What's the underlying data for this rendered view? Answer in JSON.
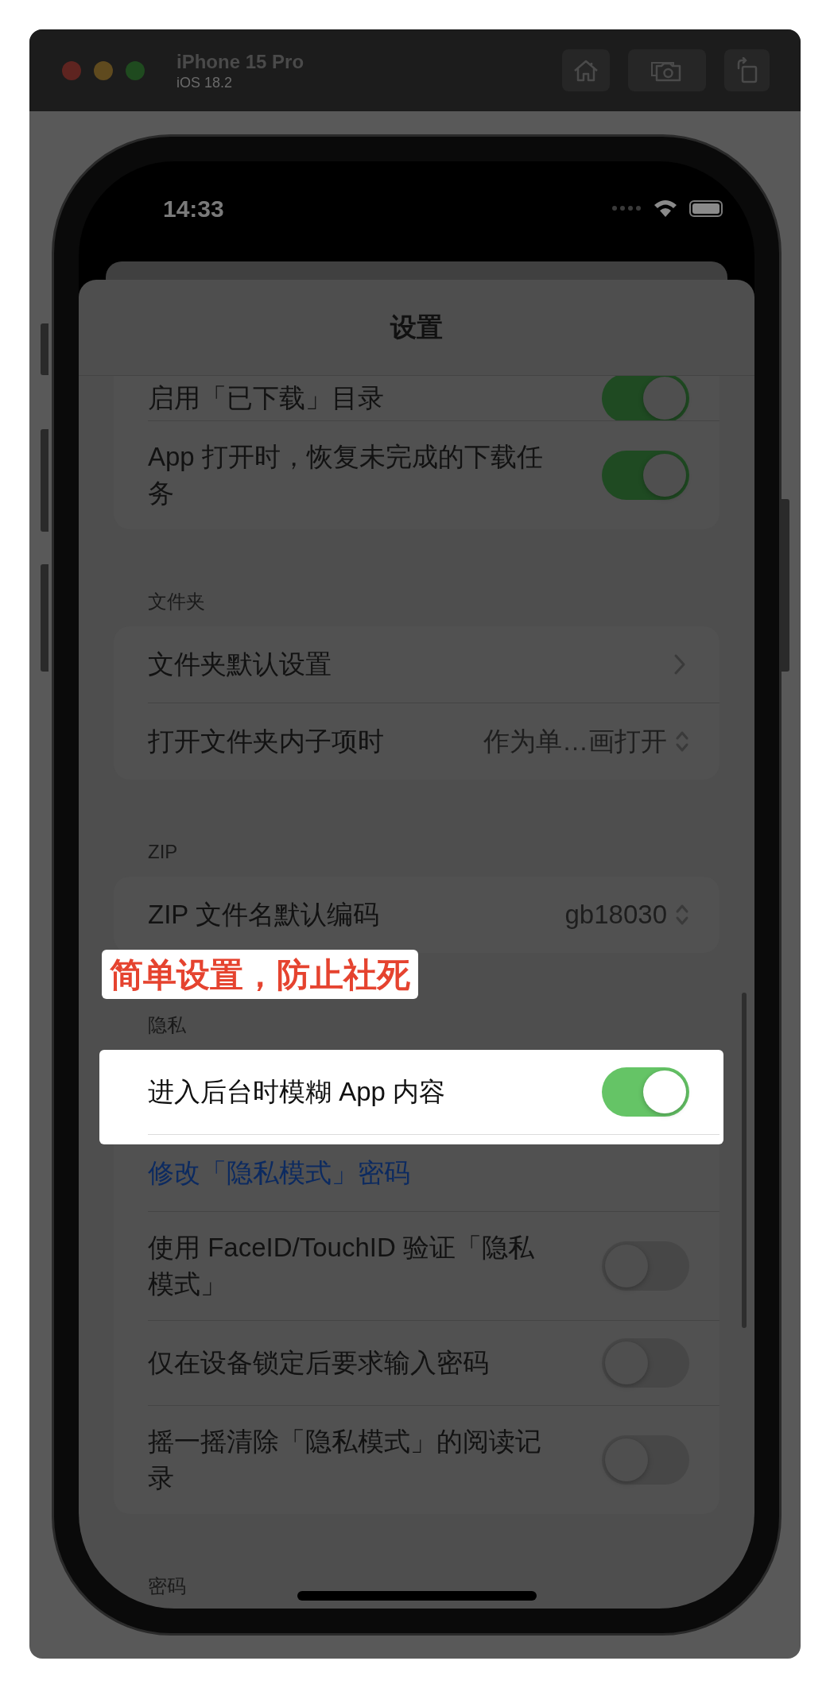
{
  "simulator": {
    "title": "iPhone 15 Pro",
    "subtitle": "iOS 18.2"
  },
  "status_bar": {
    "time": "14:33"
  },
  "sheet": {
    "title": "设置",
    "sections": [
      {
        "rows": [
          {
            "kind": "toggle",
            "label": "启用「已下载」目录",
            "on": true
          },
          {
            "kind": "toggle",
            "label": "App 打开时，恢复未完成的下载任务",
            "on": true
          }
        ]
      },
      {
        "header": "文件夹",
        "rows": [
          {
            "kind": "link",
            "label": "文件夹默认设置"
          },
          {
            "kind": "picker",
            "label": "打开文件夹内子项时",
            "value": "作为单…画打开"
          }
        ]
      },
      {
        "header": "ZIP",
        "rows": [
          {
            "kind": "picker",
            "label": "ZIP 文件名默认编码",
            "value": "gb18030"
          }
        ]
      },
      {
        "header": "隐私",
        "rows": [
          {
            "kind": "toggle",
            "label": "进入后台时模糊 App 内容",
            "on": true,
            "highlighted": true
          },
          {
            "kind": "action",
            "label": "修改「隐私模式」密码",
            "highlighted": false
          },
          {
            "kind": "toggle",
            "label": "使用 FaceID/TouchID 验证「隐私模式」",
            "on": false,
            "highlighted": false
          },
          {
            "kind": "toggle",
            "label": "仅在设备锁定后要求输入密码",
            "on": false,
            "highlighted": false
          },
          {
            "kind": "toggle",
            "label": "摇一摇清除「隐私模式」的阅读记录",
            "on": false,
            "highlighted": false
          }
        ]
      },
      {
        "header": "密码"
      }
    ]
  },
  "annotation": {
    "text": "简单设置，防止社死"
  }
}
